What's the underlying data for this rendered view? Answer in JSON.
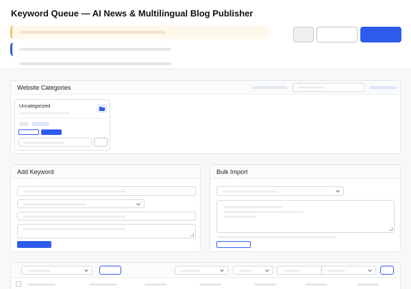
{
  "header": {
    "title": "Keyword Queue — AI News & Multilingual Blog Publisher"
  },
  "categories": {
    "title": "Website Categories",
    "card_title": "Uncategorized",
    "folder_icon": "folder-icon"
  },
  "add_keyword": {
    "title": "Add Keyword"
  },
  "bulk_import": {
    "title": "Bulk Import"
  },
  "colors": {
    "primary": "#2f5bec",
    "warning_border": "#f3c26b",
    "info_border": "#2f5bd8"
  }
}
